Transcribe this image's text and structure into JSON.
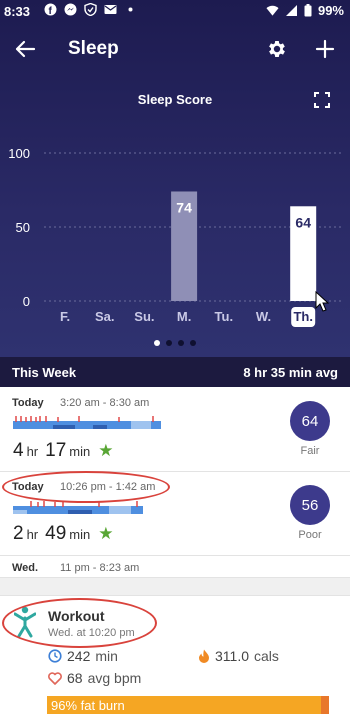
{
  "status_bar": {
    "time": "8:33",
    "battery": "99%"
  },
  "header": {
    "title": "Sleep"
  },
  "chart_title": "Sleep Score",
  "chart_data": {
    "type": "bar",
    "categories": [
      "F.",
      "Sa.",
      "Su.",
      "M.",
      "Tu.",
      "W.",
      "Th."
    ],
    "values": [
      null,
      null,
      null,
      74,
      null,
      null,
      64
    ],
    "value_labels": [
      "",
      "",
      "",
      "74",
      "",
      "",
      "64"
    ],
    "selected_category": "Th.",
    "yticks": [
      "100",
      "50",
      "0"
    ],
    "ylim": [
      0,
      100
    ],
    "colors": {
      "bar": "#8f8fb6",
      "selected_bar": "#ffffff"
    }
  },
  "pager": {
    "count": 4,
    "active": 0
  },
  "week_summary": {
    "label": "This Week",
    "average": "8 hr 35 min avg"
  },
  "entries": [
    {
      "day": "Today",
      "times": "3:20 am - 8:30 am",
      "hours": "4",
      "hr_unit": "hr",
      "minutes": "17",
      "min_unit": "min",
      "score": "64",
      "rating": "Fair"
    },
    {
      "day": "Today",
      "times": "10:26 pm - 1:42 am",
      "hours": "2",
      "hr_unit": "hr",
      "minutes": "49",
      "min_unit": "min",
      "score": "56",
      "rating": "Poor"
    },
    {
      "day": "Wed.",
      "times": "11 pm - 8:23 am"
    }
  ],
  "workout": {
    "title": "Workout",
    "subtitle": "Wed. at 10:20 pm",
    "duration_value": "242",
    "duration_unit": "min",
    "calories_value": "311.0",
    "calories_unit": "cals",
    "heart_value": "68",
    "heart_unit": "avg bpm",
    "fat_burn_label": "96% fat burn",
    "fat_burn_fraction": 0.96
  },
  "colors": {
    "accent": "#3d3a8c",
    "star": "#59a635",
    "highlight_oval": "#d9433c",
    "fat_burn": "#f5a623"
  }
}
